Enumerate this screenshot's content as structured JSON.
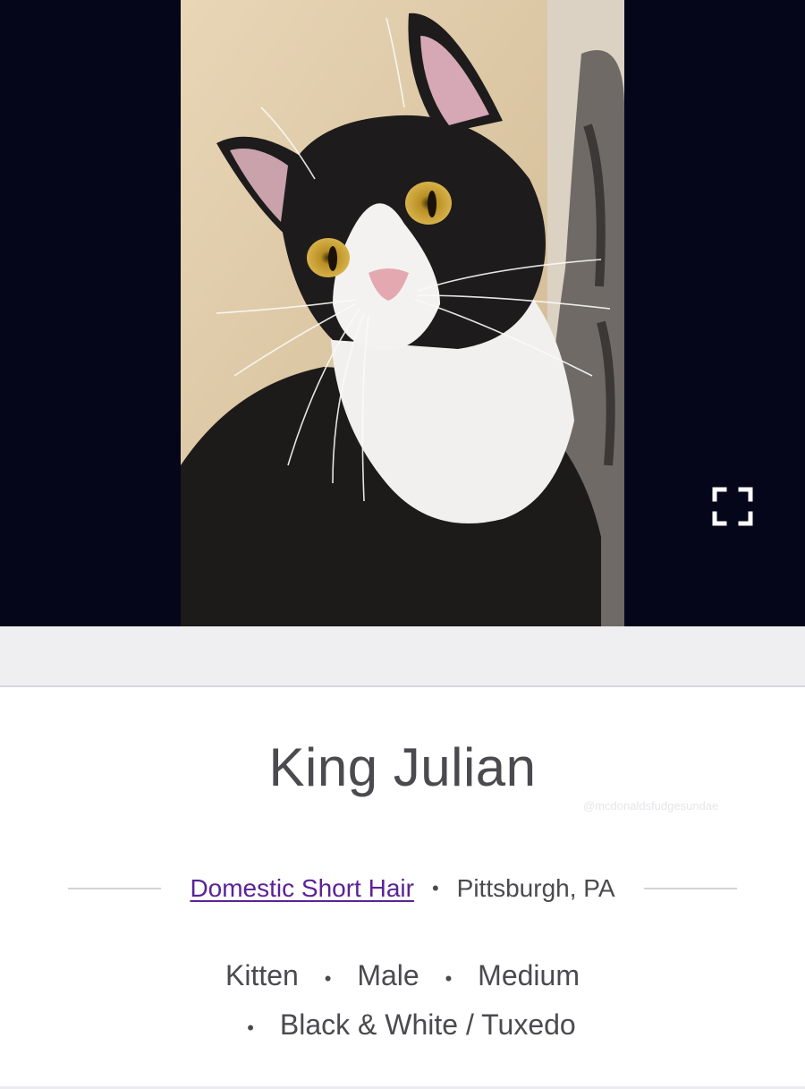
{
  "pet": {
    "name": "King Julian",
    "breed_link": "Domestic Short Hair",
    "location": "Pittsburgh, PA",
    "separator": "•",
    "attributes_line1": [
      "Kitten",
      "Male",
      "Medium"
    ],
    "attributes_line2": [
      "Black & White / Tuxedo"
    ]
  },
  "watermark": "@mcdonaldsfudgesundae",
  "icons": {
    "fullscreen": "fullscreen-expand-icon"
  },
  "colors": {
    "hero_background": "#06061a",
    "breed_link": "#5a2396",
    "text": "#4a4a4f",
    "band": "#efeff1"
  }
}
